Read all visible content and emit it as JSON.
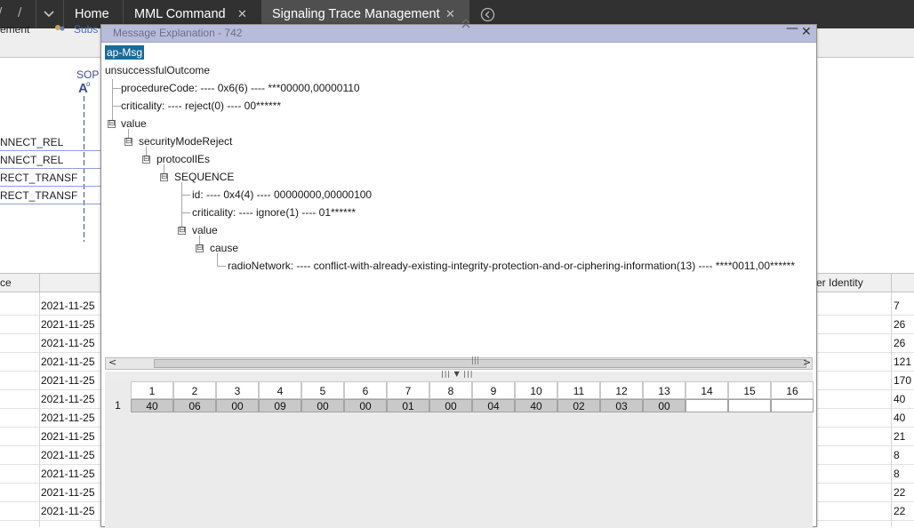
{
  "topbar": {
    "glyph_left": "/",
    "glyph_right": "/",
    "dropdown_icon": "chevron-down-icon",
    "tabs": [
      {
        "label": "Home"
      },
      {
        "label": "MML Command",
        "close": "✕"
      },
      {
        "label": "Signaling Trace Management",
        "close": "✕",
        "active": true
      }
    ],
    "nav_icon": "circle-chevron-left-icon",
    "expand_icon": "double-chevron-up-icon"
  },
  "background": {
    "toolbar_items": [
      "ement",
      "Subs"
    ],
    "flow": {
      "node_label": "SOP",
      "node_glyph": "A",
      "node_sup": "o",
      "messages": [
        "NNECT_REL",
        "NNECT_REL",
        "RECT_TRANSF",
        "RECT_TRANSF"
      ]
    },
    "grid": {
      "headers": {
        "left": "ce",
        "right": "er Identity"
      },
      "dates": [
        "2021-11-25",
        "2021-11-25",
        "2021-11-25",
        "2021-11-25",
        "2021-11-25",
        "2021-11-25",
        "2021-11-25",
        "2021-11-25",
        "2021-11-25",
        "2021-11-25",
        "2021-11-25",
        "2021-11-25"
      ],
      "identities": [
        "7",
        "26",
        "26",
        "121",
        "170",
        "40",
        "40",
        "21",
        "8",
        "8",
        "22",
        "22"
      ]
    }
  },
  "dialog": {
    "title": "Message Explanation - 742",
    "minimize": "—",
    "close": "✕",
    "tree": {
      "root": "ap-Msg",
      "nodes": [
        "unsuccessfulOutcome",
        "procedureCode: ---- 0x6(6) ---- ***00000,00000110",
        "criticality: ---- reject(0) ---- 00******",
        "value",
        "securityModeReject",
        "protocolIEs",
        "SEQUENCE",
        "id: ---- 0x4(4) ---- 00000000,00000100",
        "criticality: ---- ignore(1) ---- 01******",
        "value",
        "cause",
        "radioNetwork: ---- conflict-with-already-existing-integrity-protection-and-or-ciphering-information(13) ---- ****0011,00******"
      ],
      "toggle_symbol": "⊟"
    },
    "scroll": {
      "left": "<",
      "right": ">",
      "grip": "|||"
    },
    "splitter": {
      "grip": "|||  ▼  |||"
    },
    "hex": {
      "columns": [
        "1",
        "2",
        "3",
        "4",
        "5",
        "6",
        "7",
        "8",
        "9",
        "10",
        "11",
        "12",
        "13",
        "14",
        "15",
        "16"
      ],
      "row_label": "1",
      "bytes": [
        "40",
        "06",
        "00",
        "09",
        "00",
        "00",
        "01",
        "00",
        "04",
        "40",
        "02",
        "03",
        "00",
        "",
        "",
        ""
      ]
    }
  }
}
